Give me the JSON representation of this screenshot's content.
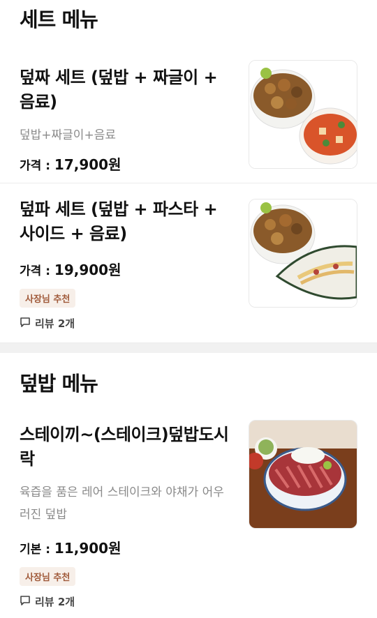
{
  "sections": [
    {
      "title": "세트 메뉴",
      "items": [
        {
          "name": "덮짜 세트 (덮밥 + 짜글이 + 음료)",
          "description": "덮밥+짜글이+음료",
          "price_label": "가격 :",
          "price": "17,900원"
        },
        {
          "name": "덮파 세트 (덮밥 + 파스타 + 사이드 + 음료)",
          "price_label": "가격 :",
          "price": "19,900원",
          "badge": "사장님 추천",
          "reviews": "리뷰 2개"
        }
      ]
    },
    {
      "title": "덮밥 메뉴",
      "items": [
        {
          "name": "스테이끼~(스테이크)덮밥도시락",
          "description": "육즙을 품은 레어 스테이크와 야채가 어우러진 덮밥",
          "price_label": "기본 :",
          "price": "11,900원",
          "badge": "사장님 추천",
          "reviews": "리뷰 2개"
        }
      ]
    }
  ],
  "icons": {
    "reviews": "speech-bubble-icon"
  }
}
